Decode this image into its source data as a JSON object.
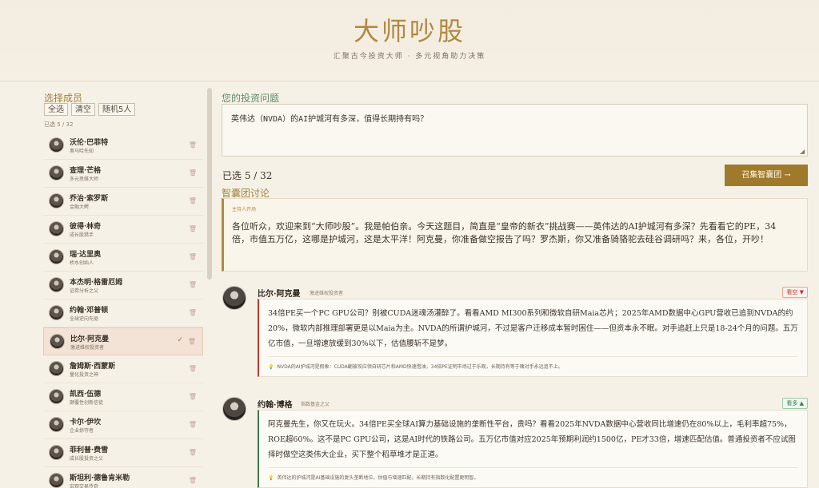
{
  "header": {
    "title": "大师吵股",
    "subtitle": "汇聚古今投资大师 · 多元视角助力决策"
  },
  "sidebar": {
    "title": "选择成员",
    "buttons": [
      "全选",
      "清空",
      "随机5人"
    ],
    "count": "已选 5 / 32",
    "members": [
      {
        "name": "沃伦·巴菲特",
        "desc": "奥马哈先知",
        "selected": false
      },
      {
        "name": "查理·芒格",
        "desc": "多元思维大师",
        "selected": false
      },
      {
        "name": "乔治·索罗斯",
        "desc": "金融大鳄",
        "selected": false
      },
      {
        "name": "彼得·林奇",
        "desc": "成长股猎手",
        "selected": false
      },
      {
        "name": "瑞·达里奥",
        "desc": "桥水创始人",
        "selected": false
      },
      {
        "name": "本杰明·格雷厄姆",
        "desc": "证券分析之父",
        "selected": false
      },
      {
        "name": "约翰·邓普顿",
        "desc": "全球逆向先驱",
        "selected": false
      },
      {
        "name": "比尔·阿克曼",
        "desc": "激进维权投资者",
        "selected": true
      },
      {
        "name": "詹姆斯·西蒙斯",
        "desc": "量化投资之神",
        "selected": false
      },
      {
        "name": "凯西·伍德",
        "desc": "颠覆性创新信徒",
        "selected": false
      },
      {
        "name": "卡尔·伊坎",
        "desc": "企业掠夺者",
        "selected": false
      },
      {
        "name": "菲利普·费雪",
        "desc": "成长股投资之父",
        "selected": false
      },
      {
        "name": "斯坦利·德鲁肯米勒",
        "desc": "宏观交易传奇",
        "selected": false
      }
    ]
  },
  "main": {
    "question_label": "您的投资问题",
    "question_value": "英伟达（NVDA）的AI护城河有多深，值得长期持有吗？",
    "selected_count": "已选 5 / 32",
    "summon_button": "召集智囊团 →",
    "discussion_label": "智囊团讨论",
    "host_tag": "主持人开场",
    "host_text": "各位听众，欢迎来到“大师吵股”。我是帕伯亲。今天这题目，简直是“皇帝的新衣”挑战赛——英伟达的AI护城河有多深？先看看它的PE，34倍，市值五万亿，这哪是护城河，这是太平洋！阿克曼，你准备做空报告了吗？罗杰斯，你又准备骑骆驼去硅谷调研吗？来，各位，开吵！"
  },
  "messages": [
    {
      "speaker": "比尔·阿克曼",
      "role": "激进维权投资者",
      "stance": "看空 ▼",
      "stance_type": "bear",
      "text": "34倍PE买一个PC GPU公司？别被CUDA迷魂汤灌醉了。看看AMD MI300系列和微软自研Maia芯片；2025年AMD数据中心GPU营收已追到NVDA的约20%，微软内部推理部署更是以Maia为主。NVDA的所谓护城河，不过是客户迁移成本暂时困住——但资本永不眠。对手追赶上只是18-24个月的问题。五万亿市值，一旦增速放缓到30%以下，估值腰斩不是梦。",
      "summary": "NVDA的AI护城河是假象：CUDA翻被攻应领自研芯片和AMD快速借油，34倍PE证明市场过于乐观，长期持有等于赌对手永远追不上。"
    },
    {
      "speaker": "约翰·博格",
      "role": "指数基金之父",
      "stance": "看多 ▲",
      "stance_type": "bull",
      "text": "阿克曼先生，你又在玩火。34倍PE买全球AI算力基础设施的垄断性平台，贵吗？看看2025年NVDA数据中心营收同比增速仍在80%以上，毛利率超75%，ROE超60%。这不是PC GPU公司，这是AI时代的铁路公司。五万亿市值对应2025年预期利润约1500亿，PE才33倍，增速匹配估值。普通投资者不应试图择时做空这类伟大企业，买下整个稻草堆才是正道。",
      "summary": "英伟达的护城河是AI基础设施的复头垄断地位，估值与增速匹配，长期持有指数化配置更明智。"
    }
  ]
}
